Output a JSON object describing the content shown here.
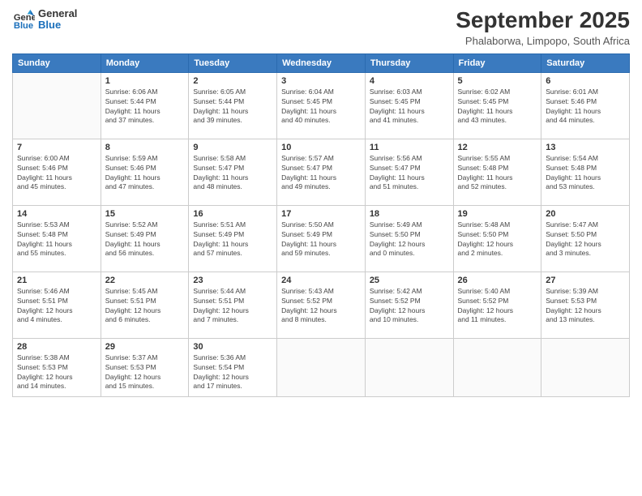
{
  "header": {
    "logo_line1": "General",
    "logo_line2": "Blue",
    "month": "September 2025",
    "location": "Phalaborwa, Limpopo, South Africa"
  },
  "weekdays": [
    "Sunday",
    "Monday",
    "Tuesday",
    "Wednesday",
    "Thursday",
    "Friday",
    "Saturday"
  ],
  "weeks": [
    [
      {
        "day": "",
        "info": ""
      },
      {
        "day": "1",
        "info": "Sunrise: 6:06 AM\nSunset: 5:44 PM\nDaylight: 11 hours\nand 37 minutes."
      },
      {
        "day": "2",
        "info": "Sunrise: 6:05 AM\nSunset: 5:44 PM\nDaylight: 11 hours\nand 39 minutes."
      },
      {
        "day": "3",
        "info": "Sunrise: 6:04 AM\nSunset: 5:45 PM\nDaylight: 11 hours\nand 40 minutes."
      },
      {
        "day": "4",
        "info": "Sunrise: 6:03 AM\nSunset: 5:45 PM\nDaylight: 11 hours\nand 41 minutes."
      },
      {
        "day": "5",
        "info": "Sunrise: 6:02 AM\nSunset: 5:45 PM\nDaylight: 11 hours\nand 43 minutes."
      },
      {
        "day": "6",
        "info": "Sunrise: 6:01 AM\nSunset: 5:46 PM\nDaylight: 11 hours\nand 44 minutes."
      }
    ],
    [
      {
        "day": "7",
        "info": "Sunrise: 6:00 AM\nSunset: 5:46 PM\nDaylight: 11 hours\nand 45 minutes."
      },
      {
        "day": "8",
        "info": "Sunrise: 5:59 AM\nSunset: 5:46 PM\nDaylight: 11 hours\nand 47 minutes."
      },
      {
        "day": "9",
        "info": "Sunrise: 5:58 AM\nSunset: 5:47 PM\nDaylight: 11 hours\nand 48 minutes."
      },
      {
        "day": "10",
        "info": "Sunrise: 5:57 AM\nSunset: 5:47 PM\nDaylight: 11 hours\nand 49 minutes."
      },
      {
        "day": "11",
        "info": "Sunrise: 5:56 AM\nSunset: 5:47 PM\nDaylight: 11 hours\nand 51 minutes."
      },
      {
        "day": "12",
        "info": "Sunrise: 5:55 AM\nSunset: 5:48 PM\nDaylight: 11 hours\nand 52 minutes."
      },
      {
        "day": "13",
        "info": "Sunrise: 5:54 AM\nSunset: 5:48 PM\nDaylight: 11 hours\nand 53 minutes."
      }
    ],
    [
      {
        "day": "14",
        "info": "Sunrise: 5:53 AM\nSunset: 5:48 PM\nDaylight: 11 hours\nand 55 minutes."
      },
      {
        "day": "15",
        "info": "Sunrise: 5:52 AM\nSunset: 5:49 PM\nDaylight: 11 hours\nand 56 minutes."
      },
      {
        "day": "16",
        "info": "Sunrise: 5:51 AM\nSunset: 5:49 PM\nDaylight: 11 hours\nand 57 minutes."
      },
      {
        "day": "17",
        "info": "Sunrise: 5:50 AM\nSunset: 5:49 PM\nDaylight: 11 hours\nand 59 minutes."
      },
      {
        "day": "18",
        "info": "Sunrise: 5:49 AM\nSunset: 5:50 PM\nDaylight: 12 hours\nand 0 minutes."
      },
      {
        "day": "19",
        "info": "Sunrise: 5:48 AM\nSunset: 5:50 PM\nDaylight: 12 hours\nand 2 minutes."
      },
      {
        "day": "20",
        "info": "Sunrise: 5:47 AM\nSunset: 5:50 PM\nDaylight: 12 hours\nand 3 minutes."
      }
    ],
    [
      {
        "day": "21",
        "info": "Sunrise: 5:46 AM\nSunset: 5:51 PM\nDaylight: 12 hours\nand 4 minutes."
      },
      {
        "day": "22",
        "info": "Sunrise: 5:45 AM\nSunset: 5:51 PM\nDaylight: 12 hours\nand 6 minutes."
      },
      {
        "day": "23",
        "info": "Sunrise: 5:44 AM\nSunset: 5:51 PM\nDaylight: 12 hours\nand 7 minutes."
      },
      {
        "day": "24",
        "info": "Sunrise: 5:43 AM\nSunset: 5:52 PM\nDaylight: 12 hours\nand 8 minutes."
      },
      {
        "day": "25",
        "info": "Sunrise: 5:42 AM\nSunset: 5:52 PM\nDaylight: 12 hours\nand 10 minutes."
      },
      {
        "day": "26",
        "info": "Sunrise: 5:40 AM\nSunset: 5:52 PM\nDaylight: 12 hours\nand 11 minutes."
      },
      {
        "day": "27",
        "info": "Sunrise: 5:39 AM\nSunset: 5:53 PM\nDaylight: 12 hours\nand 13 minutes."
      }
    ],
    [
      {
        "day": "28",
        "info": "Sunrise: 5:38 AM\nSunset: 5:53 PM\nDaylight: 12 hours\nand 14 minutes."
      },
      {
        "day": "29",
        "info": "Sunrise: 5:37 AM\nSunset: 5:53 PM\nDaylight: 12 hours\nand 15 minutes."
      },
      {
        "day": "30",
        "info": "Sunrise: 5:36 AM\nSunset: 5:54 PM\nDaylight: 12 hours\nand 17 minutes."
      },
      {
        "day": "",
        "info": ""
      },
      {
        "day": "",
        "info": ""
      },
      {
        "day": "",
        "info": ""
      },
      {
        "day": "",
        "info": ""
      }
    ]
  ]
}
